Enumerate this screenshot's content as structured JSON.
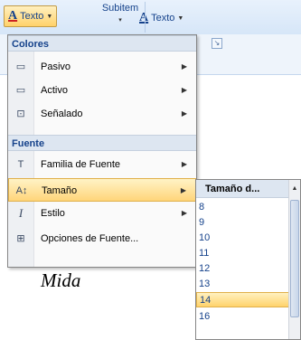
{
  "ribbon": {
    "texto_left": "Texto",
    "subitem": "Subitem",
    "texto_right": "Texto"
  },
  "menu": {
    "colores_header": "Colores",
    "pasivo": "Pasivo",
    "activo": "Activo",
    "senalado": "Señalado",
    "fuente_header": "Fuente",
    "familia": "Familia de Fuente",
    "tamano": "Tamaño",
    "estilo": "Estilo",
    "opciones": "Opciones de Fuente..."
  },
  "submenu": {
    "header": "Tamaño d...",
    "sizes": [
      "8",
      "9",
      "10",
      "11",
      "12",
      "13",
      "14",
      "16"
    ],
    "selected": "14"
  },
  "caption": "Mida"
}
